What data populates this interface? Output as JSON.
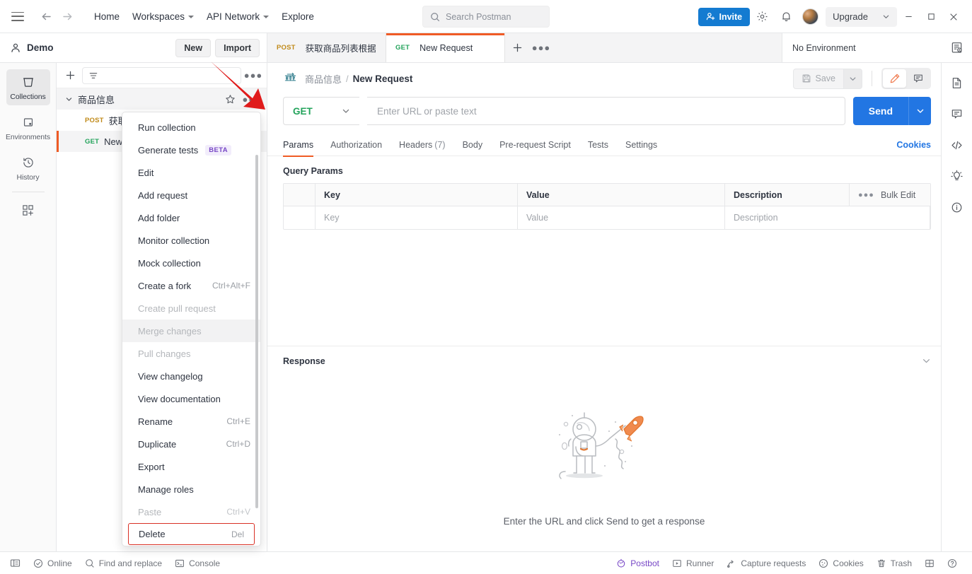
{
  "topbar": {
    "menu_icon": "hamburger-icon",
    "back_icon": "arrow-left-icon",
    "forward_icon": "arrow-right-icon",
    "nav": [
      {
        "label": "Home",
        "caret": false
      },
      {
        "label": "Workspaces",
        "caret": true
      },
      {
        "label": "API Network",
        "caret": true
      },
      {
        "label": "Explore",
        "caret": false
      }
    ],
    "search": {
      "placeholder": "Search Postman",
      "value": "",
      "icon": "search-icon"
    },
    "invite_label": "Invite",
    "settings_icon": "gear-icon",
    "notifications_icon": "bell-icon",
    "avatar": "user-avatar",
    "upgrade_label": "Upgrade",
    "window": {
      "minimize": "—",
      "maximize": "□",
      "close": "✕"
    }
  },
  "workspace": {
    "name": "Demo",
    "user_icon": "person-icon",
    "new_label": "New",
    "import_label": "Import"
  },
  "rail": {
    "items": [
      {
        "label": "Collections",
        "icon": "collection-icon",
        "active": true
      },
      {
        "label": "Environments",
        "icon": "environment-icon",
        "active": false
      },
      {
        "label": "History",
        "icon": "history-icon",
        "active": false
      }
    ],
    "add_icon": "add-grid-icon"
  },
  "sidebar": {
    "add_icon": "plus-icon",
    "filter_icon": "filter-icon",
    "filter_placeholder": "",
    "more_icon": "more-horizontal-icon",
    "collection": {
      "name": "商品信息",
      "chevron": "chevron-down-icon",
      "star_icon": "star-icon",
      "more_icon": "more-horizontal-icon"
    },
    "requests": [
      {
        "method": "POST",
        "name": "获取商品列表根据商品名称",
        "selected": false
      },
      {
        "method": "GET",
        "name": "New Request",
        "selected": true
      }
    ]
  },
  "context_menu": {
    "items": [
      {
        "label": "Run collection",
        "shortcut": "",
        "disabled": false,
        "badge": "",
        "highlighted": false
      },
      {
        "label": "Generate tests",
        "shortcut": "",
        "disabled": false,
        "badge": "BETA",
        "highlighted": false
      },
      {
        "label": "Edit",
        "shortcut": "",
        "disabled": false,
        "badge": "",
        "highlighted": false
      },
      {
        "label": "Add request",
        "shortcut": "",
        "disabled": false,
        "badge": "",
        "highlighted": false
      },
      {
        "label": "Add folder",
        "shortcut": "",
        "disabled": false,
        "badge": "",
        "highlighted": false
      },
      {
        "label": "Monitor collection",
        "shortcut": "",
        "disabled": false,
        "badge": "",
        "highlighted": false
      },
      {
        "label": "Mock collection",
        "shortcut": "",
        "disabled": false,
        "badge": "",
        "highlighted": false
      },
      {
        "label": "Create a fork",
        "shortcut": "Ctrl+Alt+F",
        "disabled": false,
        "badge": "",
        "highlighted": false
      },
      {
        "label": "Create pull request",
        "shortcut": "",
        "disabled": true,
        "badge": "",
        "highlighted": false
      },
      {
        "label": "Merge changes",
        "shortcut": "",
        "disabled": true,
        "badge": "",
        "highlighted": true
      },
      {
        "label": "Pull changes",
        "shortcut": "",
        "disabled": true,
        "badge": "",
        "highlighted": false
      },
      {
        "label": "View changelog",
        "shortcut": "",
        "disabled": false,
        "badge": "",
        "highlighted": false
      },
      {
        "label": "View documentation",
        "shortcut": "",
        "disabled": false,
        "badge": "",
        "highlighted": false
      },
      {
        "label": "Rename",
        "shortcut": "Ctrl+E",
        "disabled": false,
        "badge": "",
        "highlighted": false
      },
      {
        "label": "Duplicate",
        "shortcut": "Ctrl+D",
        "disabled": false,
        "badge": "",
        "highlighted": false
      },
      {
        "label": "Export",
        "shortcut": "",
        "disabled": false,
        "badge": "",
        "highlighted": false
      },
      {
        "label": "Manage roles",
        "shortcut": "",
        "disabled": false,
        "badge": "",
        "highlighted": false
      },
      {
        "label": "Paste",
        "shortcut": "Ctrl+V",
        "disabled": true,
        "badge": "",
        "highlighted": false
      },
      {
        "label": "Delete",
        "shortcut": "Del",
        "disabled": false,
        "badge": "",
        "highlighted": false,
        "outlined": true
      }
    ]
  },
  "tabs": {
    "items": [
      {
        "method": "POST",
        "label": "获取商品列表根据商品名",
        "active": false
      },
      {
        "method": "GET",
        "label": "New Request",
        "active": true
      }
    ],
    "add_icon": "plus-icon",
    "more_icon": "more-horizontal-icon"
  },
  "environment": {
    "selected": "No Environment",
    "caret": "chevron-down-icon",
    "eye_icon": "environment-quick-look-icon"
  },
  "right_rail": {
    "items": [
      {
        "icon": "documentation-icon"
      },
      {
        "icon": "comment-icon"
      },
      {
        "icon": "code-icon"
      },
      {
        "icon": "info-bulb-icon"
      },
      {
        "icon": "info-circle-icon"
      }
    ]
  },
  "request": {
    "breadcrumb": {
      "icon": "http-icon",
      "parent": "商品信息",
      "separator": "/",
      "current": "New Request"
    },
    "save_label": "Save",
    "save_icon": "floppy-icon",
    "save_caret": "chevron-down-icon",
    "edit_icon": "pencil-icon",
    "comment_icon": "comment-icon",
    "method": "GET",
    "url_placeholder": "Enter URL or paste text",
    "url_value": "",
    "send_label": "Send",
    "send_caret": "chevron-down-icon",
    "tabs": [
      {
        "label": "Params",
        "count": "",
        "active": true
      },
      {
        "label": "Authorization",
        "count": "",
        "active": false
      },
      {
        "label": "Headers",
        "count": "(7)",
        "active": false
      },
      {
        "label": "Body",
        "count": "",
        "active": false
      },
      {
        "label": "Pre-request Script",
        "count": "",
        "active": false
      },
      {
        "label": "Tests",
        "count": "",
        "active": false
      },
      {
        "label": "Settings",
        "count": "",
        "active": false
      }
    ],
    "cookies_label": "Cookies",
    "query_params": {
      "title": "Query Params",
      "headers": [
        "Key",
        "Value",
        "Description"
      ],
      "bulk_edit_label": "Bulk Edit",
      "bulk_more_icon": "more-horizontal-icon",
      "rows": [
        {
          "key": "Key",
          "value": "Value",
          "description": "Description"
        }
      ]
    }
  },
  "response": {
    "title": "Response",
    "collapse_icon": "chevron-down-icon",
    "empty_illustration": "astronaut-rocket-illustration",
    "empty_message": "Enter the URL and click Send to get a response"
  },
  "statusbar": {
    "left": [
      {
        "label": "",
        "icon": "sidebar-toggle-icon"
      },
      {
        "label": "Online",
        "icon": "check-circle-icon"
      },
      {
        "label": "Find and replace",
        "icon": "search-icon"
      },
      {
        "label": "Console",
        "icon": "terminal-icon"
      }
    ],
    "right": [
      {
        "label": "Postbot",
        "icon": "postbot-icon"
      },
      {
        "label": "Runner",
        "icon": "runner-icon"
      },
      {
        "label": "Capture requests",
        "icon": "capture-icon"
      },
      {
        "label": "Cookies",
        "icon": "cookie-icon"
      },
      {
        "label": "Trash",
        "icon": "trash-icon"
      },
      {
        "label": "",
        "icon": "layout-icon"
      },
      {
        "label": "",
        "icon": "help-circle-icon"
      }
    ]
  },
  "colors": {
    "accent_orange": "#ef5b25",
    "primary_blue": "#2276e3",
    "invite_blue": "#147bd1",
    "get_green": "#23a35b",
    "post_orange": "#c08a19",
    "delete_outline_red": "#d93025",
    "arrow_red": "#e01b1b",
    "beta_purple": "#7848c6"
  }
}
